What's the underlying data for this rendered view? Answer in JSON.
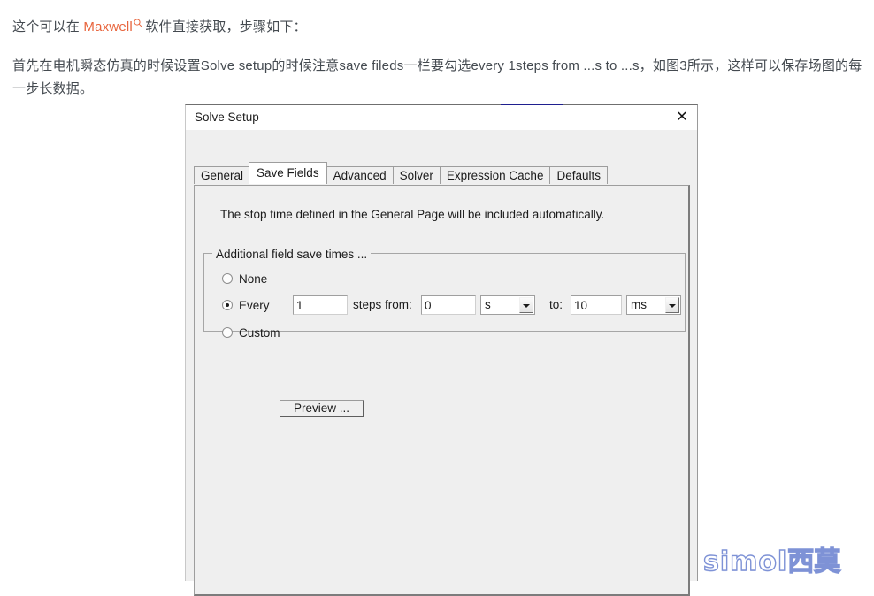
{
  "article": {
    "paragraph1": {
      "before": "这个可以在 ",
      "keyword": "Maxwell",
      "keyword_icon": "search-icon",
      "after": " 软件直接获取，步骤如下："
    },
    "paragraph2": "首先在电机瞬态仿真的时候设置Solve setup的时候注意save fileds一栏要勾选every 1steps from ...s to ...s，如图3所示，这样可以保存场图的每一步长数据。"
  },
  "dialog": {
    "title": "Solve Setup",
    "close_icon": "✕",
    "accent_color": "#1f1f8f",
    "tabs": [
      {
        "label": "General",
        "selected": false
      },
      {
        "label": "Save Fields",
        "selected": true
      },
      {
        "label": "Advanced",
        "selected": false
      },
      {
        "label": "Solver",
        "selected": false
      },
      {
        "label": "Expression Cache",
        "selected": false
      },
      {
        "label": "Defaults",
        "selected": false
      }
    ],
    "info_text": "The stop time defined in the General Page will be included automatically.",
    "groupbox": {
      "legend": "Additional field save times ...",
      "options": [
        {
          "label": "None",
          "checked": false
        },
        {
          "label": "Every",
          "checked": true
        },
        {
          "label": "Custom",
          "checked": false
        }
      ],
      "every_value": "1",
      "steps_from_label": "steps from:",
      "from_value": "0",
      "from_unit": "s",
      "to_label": "to:",
      "to_value": "10",
      "to_unit": "ms"
    },
    "preview_label": "Preview ..."
  },
  "watermark": {
    "latin": "simol",
    "cjk": "西莫",
    "color": "#7e92d6"
  }
}
